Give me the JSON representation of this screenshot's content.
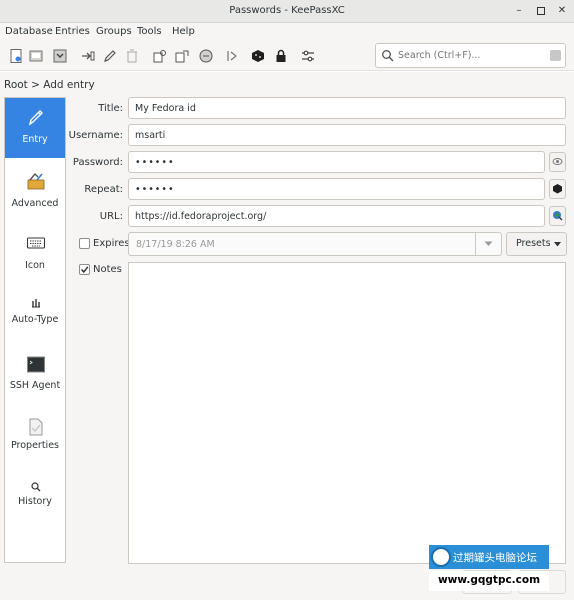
{
  "window": {
    "title": "Passwords - KeePassXC"
  },
  "menu": [
    "Database",
    "Entries",
    "Groups",
    "Tools",
    "Help"
  ],
  "toolbar": {
    "icons": [
      "new-database-icon",
      "open-database-icon",
      "save-database-icon",
      "add-entry-icon",
      "edit-entry-icon",
      "delete-entry-icon",
      "copy-username-icon",
      "copy-password-icon",
      "copy-url-icon",
      "autotype-icon",
      "password-generator-icon",
      "lock-database-icon",
      "settings-icon"
    ]
  },
  "search": {
    "placeholder": "Search (Ctrl+F)..."
  },
  "breadcrumb": "Root > Add entry",
  "sidebar": {
    "items": [
      {
        "label": "Entry",
        "icon": "pencil-icon",
        "active": true
      },
      {
        "label": "Advanced",
        "icon": "toolbox-icon",
        "active": false
      },
      {
        "label": "Icon",
        "icon": "keyboard-icon",
        "active": false
      },
      {
        "label": "Auto-Type",
        "icon": "autotype-icon",
        "active": false
      },
      {
        "label": "SSH Agent",
        "icon": "terminal-icon",
        "active": false
      },
      {
        "label": "Properties",
        "icon": "document-icon",
        "active": false
      },
      {
        "label": "History",
        "icon": "magnifier-icon",
        "active": false
      }
    ]
  },
  "form": {
    "title_label": "Title:",
    "title_value": "My Fedora id",
    "username_label": "Username:",
    "username_value": "msarti",
    "password_label": "Password:",
    "password_value": "••••••",
    "repeat_label": "Repeat:",
    "repeat_value": "••••••",
    "url_label": "URL:",
    "url_value": "https://id.fedoraproject.org/",
    "expires_label": "Expires",
    "expires_checked": false,
    "expires_value": "8/17/19 8:26 AM",
    "presets_label": "Presets",
    "notes_label": "Notes",
    "notes_checked": true,
    "notes_value": ""
  },
  "watermark": {
    "line1": "过期罐头电脑论坛",
    "line2": "www.gqgtpc.com"
  },
  "colors": {
    "accent": "#3584e4",
    "watermark": "#2a8fd6"
  }
}
